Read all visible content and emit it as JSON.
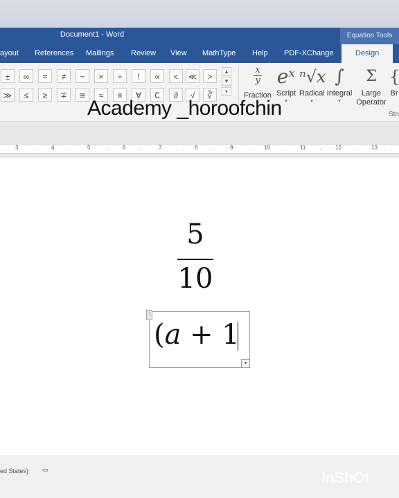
{
  "window": {
    "title": "Document1 - Word",
    "context_tab_group": "Equation Tools"
  },
  "tabs": [
    {
      "label": "ayout"
    },
    {
      "label": "References"
    },
    {
      "label": "Mailings"
    },
    {
      "label": "Review"
    },
    {
      "label": "View"
    },
    {
      "label": "MathType"
    },
    {
      "label": "Help"
    },
    {
      "label": "PDF-XChange"
    },
    {
      "label": "Design",
      "active": true
    }
  ],
  "symbols": {
    "row1": [
      "±",
      "∞",
      "=",
      "≠",
      "~",
      "×",
      "÷",
      "!",
      "∝",
      "<",
      "≪",
      ">"
    ],
    "row2": [
      "≫",
      "≤",
      "≥",
      "∓",
      "≅",
      "≈",
      "≡",
      "∀",
      "∁",
      "∂",
      "√",
      "∛"
    ]
  },
  "structures": [
    {
      "label": "Fraction",
      "icon": "fraction-icon",
      "glyph_top": "x",
      "glyph_bottom": "y"
    },
    {
      "label": "Script",
      "icon": "script-icon",
      "glyph": "eˣ"
    },
    {
      "label": "Radical",
      "icon": "radical-icon",
      "glyph": "ⁿ√x"
    },
    {
      "label": "Integral",
      "icon": "integral-icon",
      "glyph": "∫"
    },
    {
      "label": "Large Operator",
      "line1": "Large",
      "line2": "Operator",
      "icon": "summation-icon",
      "glyph": "Σ"
    },
    {
      "label": "Br",
      "icon": "bracket-icon",
      "glyph": "{"
    }
  ],
  "structures_group_label": "Stru",
  "watermark": "Academy _horoofchin",
  "ruler": {
    "numbers": [
      "3",
      "4",
      "5",
      "6",
      "7",
      "8",
      "9",
      "10",
      "11",
      "12",
      "13"
    ]
  },
  "document": {
    "fraction": {
      "numerator": "5",
      "denominator": "10"
    },
    "equation": {
      "open_paren": "(",
      "variable": "a",
      "rest": " + 1"
    }
  },
  "status": {
    "text": "ed States)"
  },
  "brand_watermark": "InShOt",
  "colors": {
    "ribbon_blue": "#2b579a",
    "context_tab": "#4a73b0"
  }
}
